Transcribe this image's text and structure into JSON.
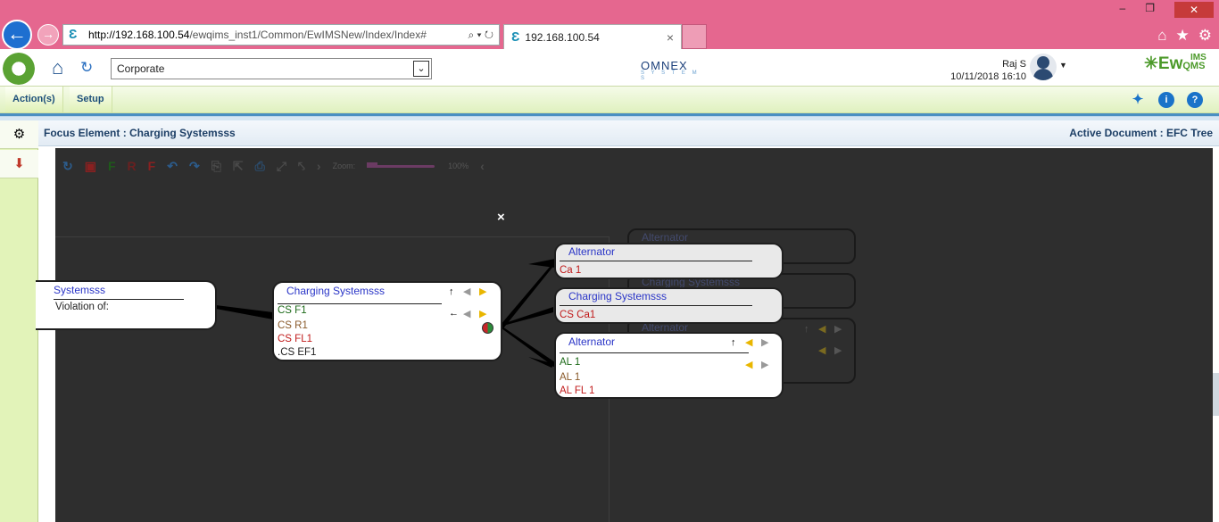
{
  "browser": {
    "url_domain": "http://192.168.100.54",
    "url_path": "/ewqims_inst1/Common/EwIMSNew/Index/Index#",
    "url_controls": "⌕ ▾ ↻",
    "tab_title": "192.168.100.54",
    "tab_close": "×",
    "window_controls": [
      "–",
      "❐",
      "✕"
    ],
    "toolbar_icons": [
      "⌂",
      "★",
      "⚙"
    ]
  },
  "app": {
    "select_value": "Corporate",
    "company_logo": "OMNEX",
    "company_logo_sub": "S Y S T E M S",
    "user_name": "Raj S",
    "datetime": "10/11/2018 16:10",
    "product_name": "Ew",
    "product_suffix": "QMS",
    "product_ims": "IMS"
  },
  "menu": {
    "items": [
      "Action(s)",
      "Setup"
    ]
  },
  "focus_bar": {
    "left": "Focus Element : Charging Systemsss",
    "right": "Active Document : EFC Tree"
  },
  "toolbar": {
    "icons": [
      "↻",
      "▣",
      "F",
      "R",
      "F",
      "↶",
      "↷",
      "⎘",
      "⇱",
      "⎙",
      "⤢",
      "⤣",
      "›"
    ],
    "zoom_label": "Zoom:",
    "zoom_value": "100%",
    "zoom_level": 1.0,
    "collapse": "‹"
  },
  "dialog": {
    "close": "×"
  },
  "tree": {
    "left_node": {
      "title": "Systemsss",
      "line": "Violation of:"
    },
    "center_node": {
      "title": "Charging Systemsss",
      "items": [
        "CS F1",
        "CS R1",
        "CS FL1",
        ".CS EF1"
      ]
    },
    "right_nodes": [
      {
        "title": "Alternator",
        "items": [
          "Ca 1"
        ]
      },
      {
        "title": "Charging Systemsss",
        "items": [
          "CS Ca1"
        ]
      },
      {
        "title": "Alternator",
        "items": [
          "AL 1",
          "AL 1",
          "AL FL 1"
        ]
      }
    ],
    "ghost_nodes": [
      "Alternator",
      "Charging Systemsss",
      "Alternator"
    ],
    "arrow_up": "↑",
    "arrow_left": "←"
  },
  "colors": {
    "title_bar": "#e5678f",
    "menu_bg": "#e0f1bf",
    "canvas_bg": "#2e2e2e",
    "node_title": "#2a35c7",
    "function": "#1e6b1a",
    "requirement": "#8a5a2a",
    "failure": "#c01a1a"
  }
}
